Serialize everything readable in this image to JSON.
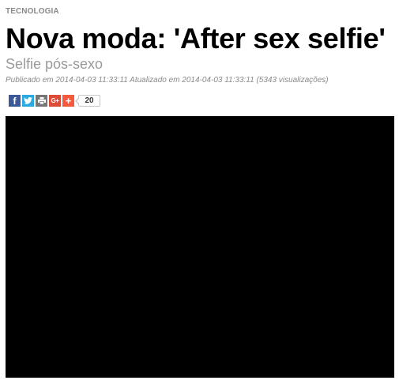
{
  "article": {
    "category": "TECNOLOGIA",
    "title": "Nova moda: 'After sex selfie'",
    "subtitle": "Selfie pós-sexo",
    "meta": "Publicado em 2014-04-03 11:33:11 Atualizado em 2014-04-03 11:33:11 (5343 visualizações)"
  },
  "share": {
    "buttons": [
      {
        "icon": "facebook-icon",
        "label": "f",
        "color": "#3b5998"
      },
      {
        "icon": "twitter-icon",
        "label": "",
        "color": "#2ba9e1"
      },
      {
        "icon": "print-icon",
        "label": "",
        "color": "#777777"
      },
      {
        "icon": "google-plus-icon",
        "label": "G+",
        "color": "#dd4b39"
      },
      {
        "icon": "plus-icon",
        "label": "+",
        "color": "#f65a3e"
      }
    ],
    "count": "20"
  },
  "video": {
    "background": "#000000"
  }
}
